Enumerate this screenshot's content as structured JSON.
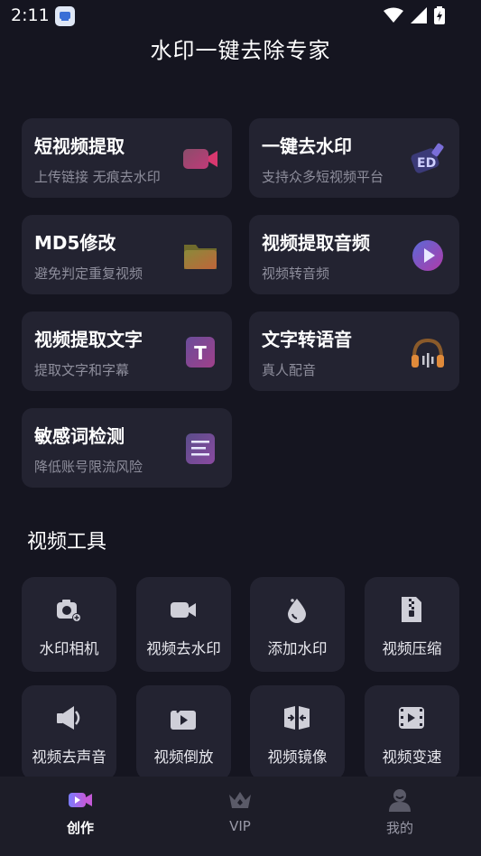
{
  "status_bar": {
    "time": "2:11"
  },
  "page_title": "水印一键去除专家",
  "features": [
    {
      "title": "短视频提取",
      "subtitle": "上传链接 无痕去水印",
      "icon": "video-camera-icon"
    },
    {
      "title": "一键去水印",
      "subtitle": "支持众多短视频平台",
      "icon": "stamp-icon",
      "badge": "ED"
    },
    {
      "title": "MD5修改",
      "subtitle": "避免判定重复视频",
      "icon": "folder-icon"
    },
    {
      "title": "视频提取音频",
      "subtitle": "视频转音频",
      "icon": "audio-icon"
    },
    {
      "title": "视频提取文字",
      "subtitle": "提取文字和字幕",
      "icon": "text-icon",
      "badge": "T"
    },
    {
      "title": "文字转语音",
      "subtitle": "真人配音",
      "icon": "headphones-icon"
    },
    {
      "title": "敏感词检测",
      "subtitle": "降低账号限流风险",
      "icon": "document-icon"
    }
  ],
  "section_title": "视频工具",
  "tools": [
    {
      "label": "水印相机",
      "icon": "camera-icon"
    },
    {
      "label": "视频去水印",
      "icon": "video-icon"
    },
    {
      "label": "添加水印",
      "icon": "drop-icon"
    },
    {
      "label": "视频压缩",
      "icon": "zip-icon"
    },
    {
      "label": "视频去声音",
      "icon": "speaker-mute-icon"
    },
    {
      "label": "视频倒放",
      "icon": "rewind-icon"
    },
    {
      "label": "视频镜像",
      "icon": "mirror-icon"
    },
    {
      "label": "视频变速",
      "icon": "speed-icon"
    }
  ],
  "tabs": [
    {
      "label": "创作",
      "icon": "create-icon",
      "active": true
    },
    {
      "label": "VIP",
      "icon": "crown-icon",
      "active": false
    },
    {
      "label": "我的",
      "icon": "profile-icon",
      "active": false
    }
  ]
}
